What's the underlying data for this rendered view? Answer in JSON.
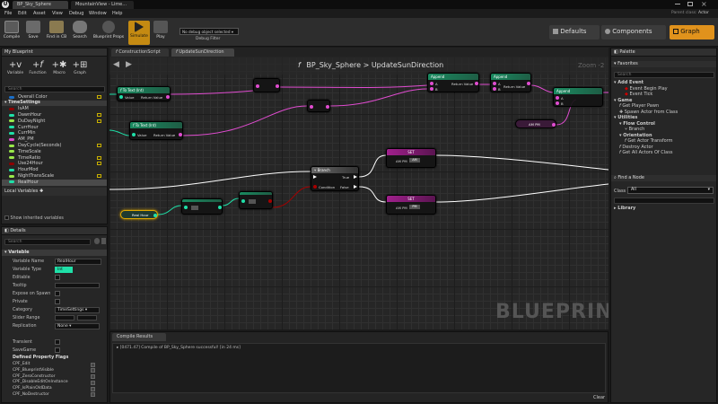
{
  "tabs": [
    "BP_Sky_Sphere",
    "MountainView - Lime...",
    "",
    "Actor"
  ],
  "parent_class": "Parent class:",
  "parent_class_value": "Actor",
  "menu": [
    "File",
    "Edit",
    "Asset",
    "View",
    "Debug",
    "Window",
    "Help"
  ],
  "toolbar": {
    "compile": "Compile",
    "save": "Save",
    "find_cb": "Find in CB",
    "search": "Search",
    "props": "Blueprint Props",
    "simulate": "Simulate",
    "play": "Play",
    "debug_select": "No debug object selected",
    "debug_filter": "Debug Filter"
  },
  "modes": {
    "defaults": "Defaults",
    "components": "Components",
    "graph": "Graph"
  },
  "myblueprint": {
    "title": "My Blueprint",
    "buttons": [
      "Variable",
      "Function",
      "Macro",
      "Graph"
    ],
    "search_placeholder": "Search",
    "top_item": "Overall Color",
    "category": "TimeSettings",
    "variables": [
      "IsAM",
      "DawnHour",
      "DuDayNight",
      "CurrHour",
      "CurrMin",
      "AM_PM",
      "DayCycle(Seconds)",
      "TimeScale",
      "TimeRatio",
      "Use24Hour",
      "HourMod",
      "NightTransScale",
      "RealHour"
    ],
    "local_vars": "Local Variables",
    "show_inherited": "Show inherited variables"
  },
  "details": {
    "title": "Details",
    "search_placeholder": "Search",
    "section": "Variable",
    "rows": [
      {
        "label": "Variable Name",
        "value": "RealHour"
      },
      {
        "label": "Variable Type",
        "value": "Int"
      },
      {
        "label": "Editable",
        "value": ""
      },
      {
        "label": "Tooltip",
        "value": ""
      },
      {
        "label": "Expose on Spawn",
        "value": ""
      },
      {
        "label": "Private",
        "value": ""
      },
      {
        "label": "Category",
        "value": "TimeSettings"
      },
      {
        "label": "Slider Range",
        "value": ""
      },
      {
        "label": "Replication",
        "value": "None"
      }
    ],
    "extra": [
      "Transient",
      "SaveGame"
    ],
    "flags_title": "Defined Property Flags",
    "flags": [
      "CPF_Edit",
      "CPF_BlueprintVisible",
      "CPF_ZeroConstructor",
      "CPF_DisableEditOnInstance",
      "CPF_IsPlainOldData",
      "CPF_NoDestructor"
    ]
  },
  "graph": {
    "tabs": [
      "ConstructionScript",
      "UpdateSunDirection"
    ],
    "breadcrumb_fn": "f",
    "breadcrumb_bp": "BP_Sky_Sphere",
    "breadcrumb_graph": "UpdateSunDirection",
    "zoom": "Zoom -2",
    "watermark": "BLUEPRINT"
  },
  "nodes": {
    "to_text_1": "To Text (Int)",
    "to_text_2": "To Text (Int)",
    "value": "Value",
    "return_value": "Return Value",
    "append": "Append",
    "branch": "Branch",
    "condition": "Condition",
    "true_lbl": "True",
    "false_lbl": "False",
    "set": "SET",
    "am_pm": "AM PM",
    "am_val": "AM",
    "pm_val": "PM",
    "real_hour": "Real Hour",
    "am_pm_get": "AM PM",
    "a": "A",
    "b": "B"
  },
  "compile": {
    "title": "Compile Results",
    "message": "[0471.47] Compile of BP_Sky_Sphere successful! [in 24 ms]",
    "clear": "Clear"
  },
  "palette": {
    "title": "Palette",
    "favorites": "Favorites",
    "search_placeholder": "Search",
    "items": [
      {
        "text": "Add Event",
        "level": 0
      },
      {
        "text": "Event Begin Play",
        "level": 2
      },
      {
        "text": "Event Tick",
        "level": 2
      },
      {
        "text": "Game",
        "level": 0
      },
      {
        "text": "Get Player Pawn",
        "level": 1
      },
      {
        "text": "Spawn Actor from Class",
        "level": 1
      },
      {
        "text": "Utilities",
        "level": 0
      },
      {
        "text": "Flow Control",
        "level": 1
      },
      {
        "text": "Branch",
        "level": 2
      },
      {
        "text": "Orientation",
        "level": 1
      },
      {
        "text": "Get Actor Transform",
        "level": 2
      },
      {
        "text": "Destroy Actor",
        "level": 1
      },
      {
        "text": "Get All Actors Of Class",
        "level": 1
      }
    ],
    "find_node": "Find a Node",
    "class_label": "Class",
    "class_value": "All",
    "library": "Library"
  }
}
